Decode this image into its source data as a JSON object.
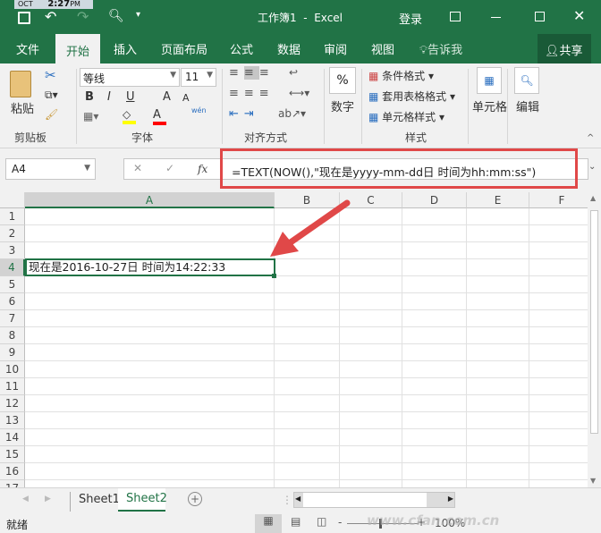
{
  "clock": {
    "month": "OCT",
    "time": "2:27",
    "ampm": "PM"
  },
  "title": {
    "text": "工作簿1  -  Excel",
    "login": "登录"
  },
  "menu": {
    "tabs": [
      "文件",
      "开始",
      "插入",
      "页面布局",
      "公式",
      "数据",
      "审阅",
      "视图"
    ],
    "tell_me": "告诉我",
    "share": "共享",
    "active": "开始"
  },
  "ribbon": {
    "clipboard": {
      "paste": "粘贴",
      "label": "剪贴板"
    },
    "font": {
      "name": "等线",
      "size": "11",
      "bold": "B",
      "italic": "I",
      "underline": "U",
      "grow": "A",
      "shrink": "A",
      "color": "A",
      "phonetic": "wén",
      "label": "字体",
      "fill_color": "#ffff00",
      "font_color": "#ff0000"
    },
    "align": {
      "label": "对齐方式"
    },
    "number": {
      "symbol": "%",
      "label": "数字"
    },
    "styles": {
      "cond": "条件格式",
      "table": "套用表格格式",
      "cell": "单元格样式",
      "label": "样式"
    },
    "cells": {
      "label": "单元格"
    },
    "edit": {
      "label": "编辑"
    }
  },
  "formula_bar": {
    "name_box": "A4",
    "fx": "fx",
    "formula": "=TEXT(NOW(),\"现在是yyyy-mm-dd日 时间为hh:mm:ss\")"
  },
  "grid": {
    "columns": [
      "A",
      "B",
      "C",
      "D",
      "E",
      "F"
    ],
    "rows": [
      "1",
      "2",
      "3",
      "4",
      "5",
      "6",
      "7",
      "8",
      "9",
      "10",
      "11",
      "12",
      "13",
      "14",
      "15",
      "16",
      "17"
    ],
    "selected": "A4",
    "a4_value": "现在是2016-10-27日 时间为14:22:33"
  },
  "sheets": {
    "tabs": [
      "Sheet1",
      "Sheet2"
    ],
    "active": "Sheet2"
  },
  "status": {
    "ready": "就绪",
    "zoom": "100%",
    "watermark": "www.cfan.com.cn"
  },
  "colors": {
    "accent": "#217346",
    "highlight_box": "#e04848"
  }
}
